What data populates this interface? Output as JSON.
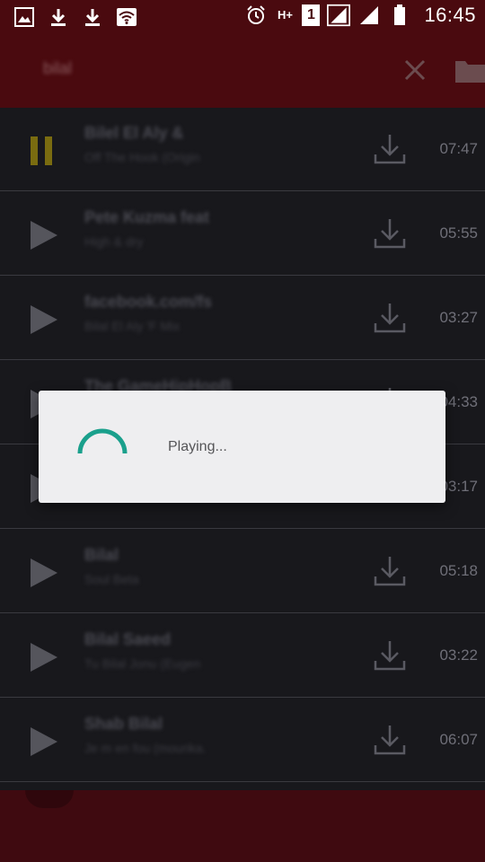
{
  "status_bar": {
    "time": "16:45",
    "network_type": "H+",
    "sim_slot": "1",
    "left_icons": [
      "gallery-icon",
      "download-icon",
      "download-icon",
      "wifi-icon"
    ],
    "right_icons": [
      "alarm-icon",
      "signal-icon",
      "signal-icon",
      "battery-icon"
    ]
  },
  "toolbar": {
    "search_query": "bilal",
    "close_icon": "close-icon",
    "folder_icon": "folder-icon"
  },
  "tracks": [
    {
      "title": "Bilel El Aly &",
      "subtitle": "Off The Hook (Origin",
      "duration": "07:47",
      "state": "playing"
    },
    {
      "title": "Pete Kuzma feat",
      "subtitle": "High & dry",
      "duration": "05:55",
      "state": "paused"
    },
    {
      "title": "facebook.com/fs",
      "subtitle": "Bilal El Aly 'F Mix",
      "duration": "03:27",
      "state": "paused"
    },
    {
      "title": "The GameHipHopB",
      "subtitle": "",
      "duration": "04:33",
      "state": "paused"
    },
    {
      "title": "",
      "subtitle": "",
      "duration": "03:17",
      "state": "paused"
    },
    {
      "title": "Bilal",
      "subtitle": "Soul Beta",
      "duration": "05:18",
      "state": "paused"
    },
    {
      "title": "Bilal Saeed",
      "subtitle": "Tu Bilal Jonu (Eugen",
      "duration": "03:22",
      "state": "paused"
    },
    {
      "title": "Shab Bilal",
      "subtitle": "Je m en fou (mourika.",
      "duration": "06:07",
      "state": "paused"
    }
  ],
  "dialog": {
    "message": "Playing...",
    "spinner_color": "#1aa08c"
  },
  "colors": {
    "toolbar": "#4a0a0f",
    "list_background": "#18181c",
    "pause_accent": "#8a7a12",
    "dialog_background": "#eeeef0"
  }
}
